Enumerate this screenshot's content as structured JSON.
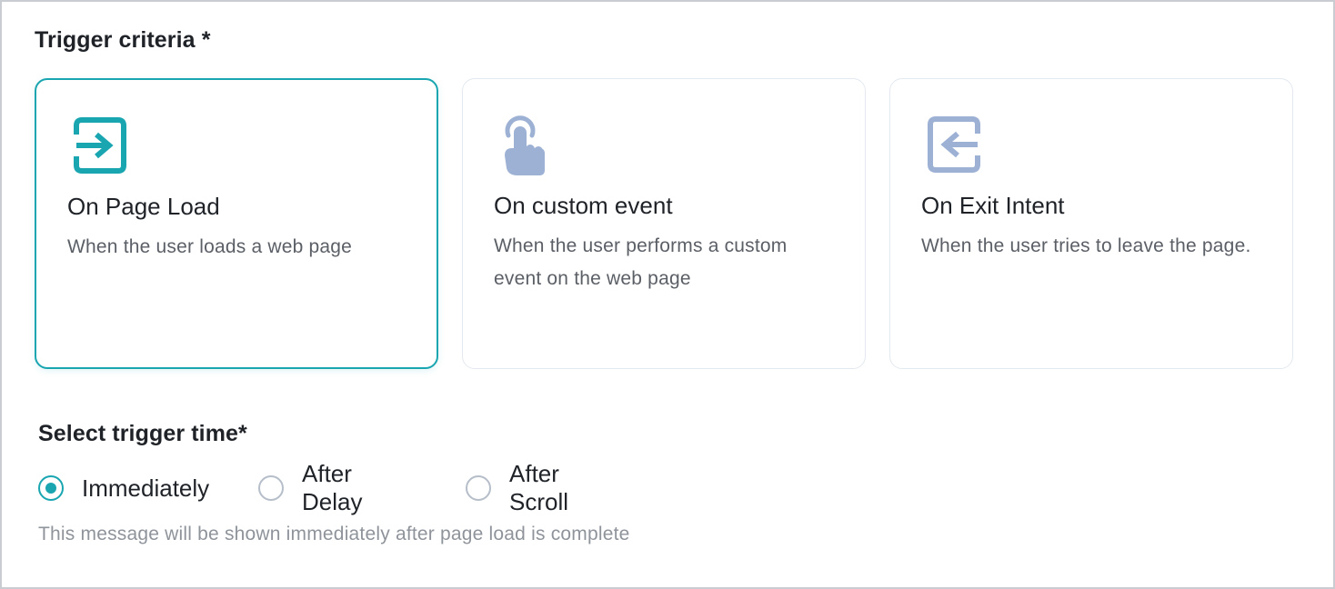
{
  "trigger_criteria": {
    "title": "Trigger criteria *",
    "options": [
      {
        "title": "On Page Load",
        "description": "When the user loads a web page",
        "icon": "enter-icon",
        "selected": true
      },
      {
        "title": "On custom event",
        "description": "When the user performs a custom event on the web page",
        "icon": "tap-hand-icon",
        "selected": false
      },
      {
        "title": "On Exit Intent",
        "description": "When the user tries to leave the page.",
        "icon": "exit-icon",
        "selected": false
      }
    ]
  },
  "trigger_time": {
    "title": "Select trigger time*",
    "options": [
      {
        "label": "Immediately",
        "selected": true
      },
      {
        "label": "After Delay",
        "selected": false
      },
      {
        "label": "After Scroll",
        "selected": false
      }
    ],
    "helper_text": "This message will be shown immediately after page load is complete"
  },
  "colors": {
    "accent": "#1aa6b1",
    "icon_inactive": "#9db1d4",
    "card_border": "#e3e9ef"
  }
}
